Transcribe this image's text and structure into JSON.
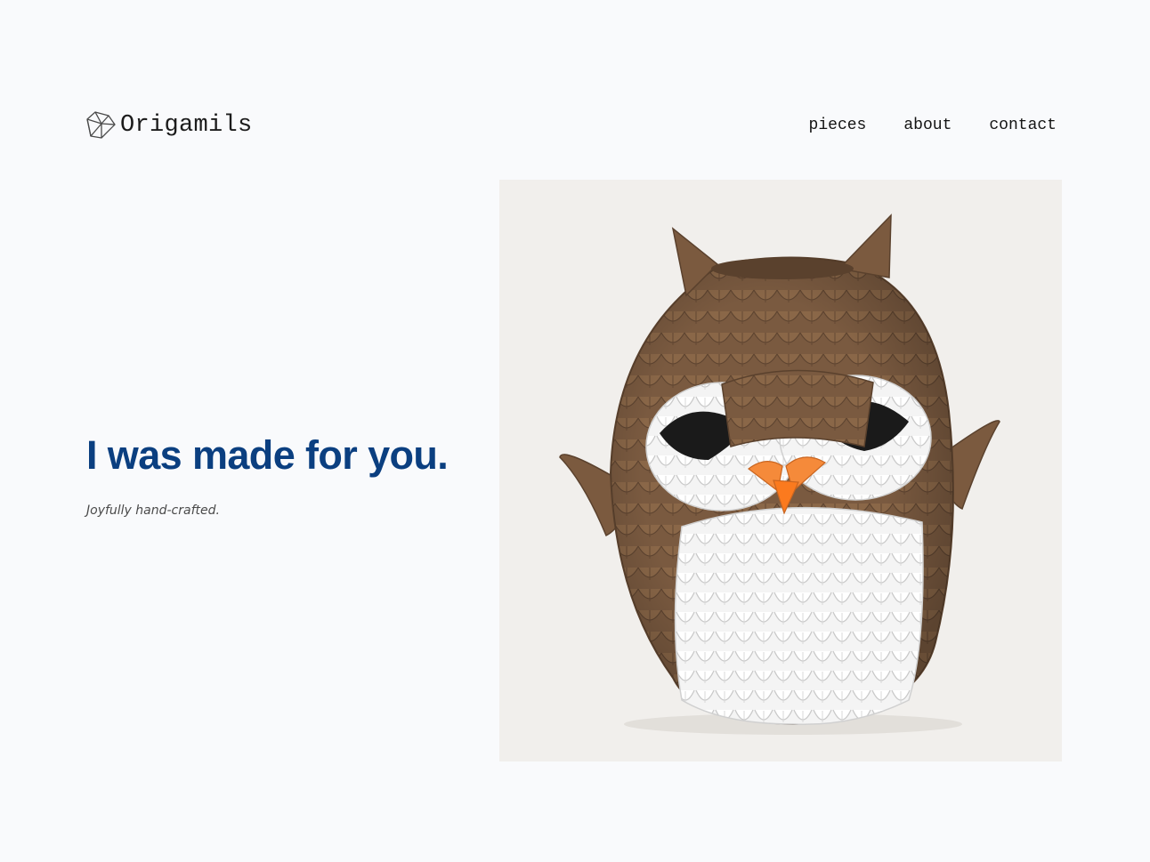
{
  "brand": {
    "name": "Origamils",
    "logo_icon": "paper-gem-logo-icon"
  },
  "nav": {
    "items": [
      "pieces",
      "about",
      "contact"
    ]
  },
  "hero": {
    "title": "I was made for you.",
    "subtitle": "Joyfully hand-crafted.",
    "image_subject": "3D origami owl",
    "colors": {
      "title": "#0b3f80",
      "owl_brown": "#7a5a40",
      "owl_white": "#ffffff",
      "owl_beak": "#f58a3a",
      "owl_eye": "#1a1a1a",
      "photo_bg": "#f1efec"
    }
  }
}
